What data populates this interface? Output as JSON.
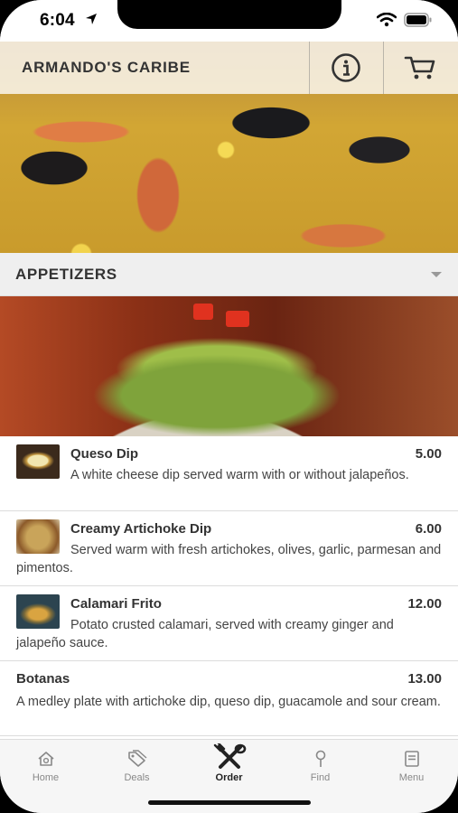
{
  "status": {
    "time": "6:04"
  },
  "header": {
    "title": "ARMANDO'S CARIBE",
    "info_icon": "info-icon",
    "cart_icon": "cart-icon"
  },
  "category": {
    "title": "APPETIZERS",
    "icon": "chevron-down-icon"
  },
  "items": [
    {
      "name": "Queso Dip",
      "price": "5.00",
      "description": "A white cheese dip served warm with or without jalapeños."
    },
    {
      "name": "Creamy Artichoke Dip",
      "price": "6.00",
      "description": "Served warm with fresh artichokes, olives, garlic, parmesan and pimentos."
    },
    {
      "name": "Calamari Frito",
      "price": "12.00",
      "description": "Potato crusted calamari, served with creamy ginger and jalapeño sauce."
    },
    {
      "name": "Botanas",
      "price": "13.00",
      "description": "A medley plate with artichoke dip, queso dip, guacamole and sour cream."
    }
  ],
  "tabs": [
    {
      "label": "Home",
      "icon": "home-icon"
    },
    {
      "label": "Deals",
      "icon": "tag-icon"
    },
    {
      "label": "Order",
      "icon": "utensils-icon"
    },
    {
      "label": "Find",
      "icon": "pin-icon"
    },
    {
      "label": "Menu",
      "icon": "menu-book-icon"
    }
  ],
  "colors": {
    "accent": "#222222",
    "header_overlay": "#ffffff",
    "category_bg": "#efefef"
  }
}
